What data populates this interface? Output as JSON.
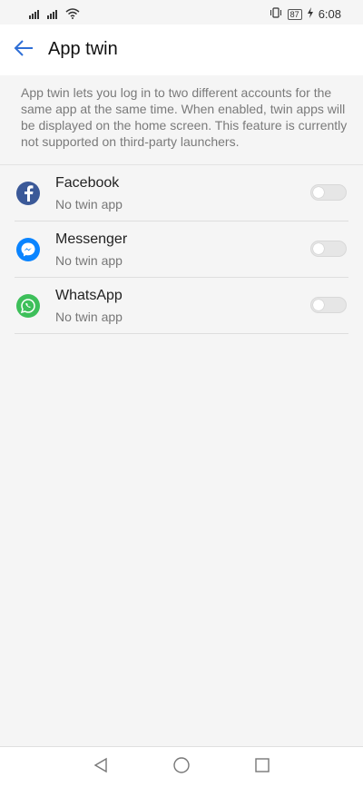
{
  "status_bar": {
    "time": "6:08",
    "battery": "87"
  },
  "header": {
    "title": "App twin"
  },
  "description": "App twin lets you log in to two different accounts for the same app at the same time. When enabled, twin apps will be displayed on the home screen. This feature is currently not supported on third-party launchers.",
  "apps": [
    {
      "name": "Facebook",
      "status": "No twin app",
      "icon": "facebook-icon",
      "color": "#3b5998",
      "enabled": false
    },
    {
      "name": "Messenger",
      "status": "No twin app",
      "icon": "messenger-icon",
      "color": "#0a84ff",
      "enabled": false
    },
    {
      "name": "WhatsApp",
      "status": "No twin app",
      "icon": "whatsapp-icon",
      "color": "#3dbf5a",
      "enabled": false
    }
  ],
  "colors": {
    "accent": "#2f6fd6",
    "background": "#f5f5f5"
  },
  "nav_bar": {
    "back": "back-triangle-icon",
    "home": "home-circle-icon",
    "recents": "recents-square-icon"
  }
}
